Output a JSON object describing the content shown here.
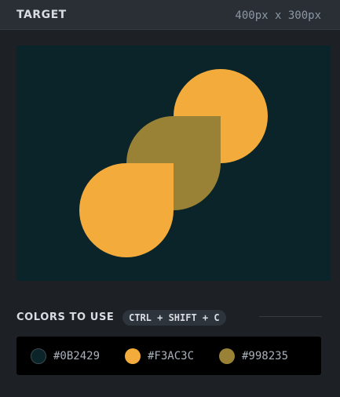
{
  "header": {
    "title": "TARGET",
    "size": "400px x 300px"
  },
  "target": {
    "background": "#0B2429",
    "shapes": [
      {
        "name": "top-circle",
        "color": "#F3AC3C"
      },
      {
        "name": "middle-drop",
        "color": "#998235"
      },
      {
        "name": "bottom-drop",
        "color": "#F3AC3C"
      }
    ]
  },
  "colors_section": {
    "label": "COLORS TO USE",
    "shortcut": "CTRL + SHIFT + C"
  },
  "palette": [
    {
      "hex": "#0B2429",
      "label": "#0B2429"
    },
    {
      "hex": "#F3AC3C",
      "label": "#F3AC3C"
    },
    {
      "hex": "#998235",
      "label": "#998235"
    }
  ]
}
